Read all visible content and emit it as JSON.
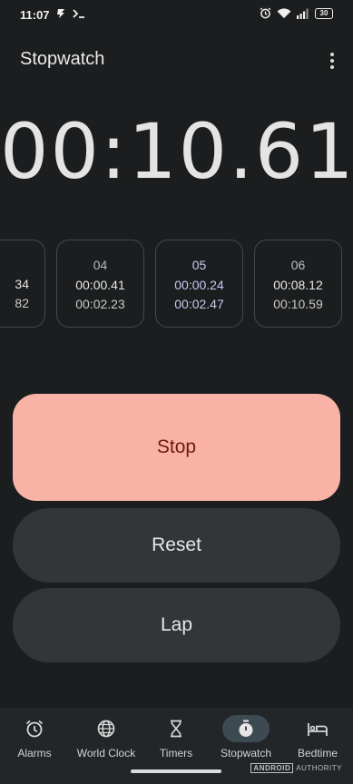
{
  "status_bar": {
    "time": "11:07",
    "left_icons": [
      "flash-icon",
      "terminal-icon"
    ],
    "battery": "30"
  },
  "app_bar": {
    "title": "Stopwatch"
  },
  "timer": {
    "display": "00:10.61"
  },
  "laps": [
    {
      "number": "",
      "lap_time": "34",
      "total_time": "82"
    },
    {
      "number": "04",
      "lap_time": "00:00.41",
      "total_time": "00:02.23"
    },
    {
      "number": "05",
      "lap_time": "00:00.24",
      "total_time": "00:02.47"
    },
    {
      "number": "06",
      "lap_time": "00:08.12",
      "total_time": "00:10.59"
    }
  ],
  "buttons": {
    "stop": "Stop",
    "reset": "Reset",
    "lap": "Lap"
  },
  "bottom_nav": {
    "items": [
      {
        "label": "Alarms",
        "icon": "alarm-icon"
      },
      {
        "label": "World Clock",
        "icon": "globe-icon"
      },
      {
        "label": "Timers",
        "icon": "hourglass-icon"
      },
      {
        "label": "Stopwatch",
        "icon": "stopwatch-icon",
        "active": true
      },
      {
        "label": "Bedtime",
        "icon": "bed-icon"
      }
    ]
  },
  "watermark": {
    "brand": "ANDROID",
    "suffix": "AUTHORITY"
  },
  "colors": {
    "background": "#1b1d1e",
    "stop_button": "#f8b3a6",
    "stop_text": "#6e1812",
    "secondary_button": "#323638",
    "highlight_lap": "#c6cbf4",
    "nav_active_pill": "#3d4a52"
  }
}
